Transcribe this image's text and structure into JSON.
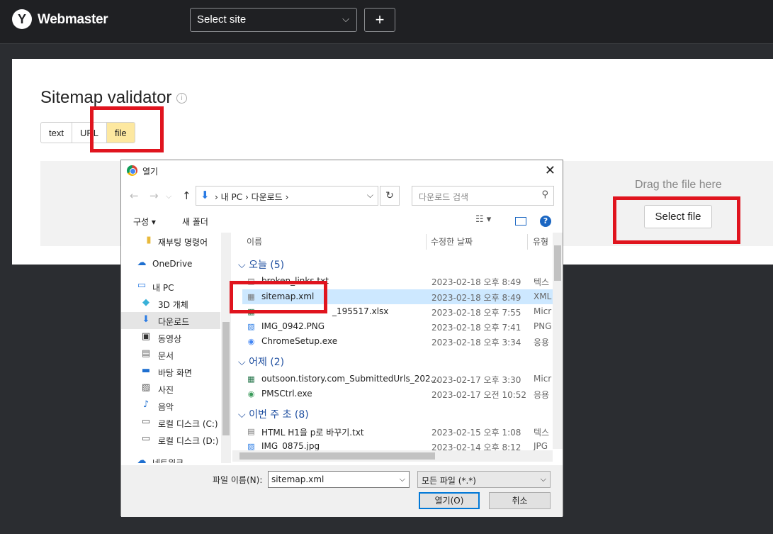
{
  "topbar": {
    "logo_letter": "Y",
    "brand": "Webmaster",
    "site_select": "Select site",
    "add_label": "+"
  },
  "page": {
    "title": "Sitemap validator",
    "info": "i",
    "tabs": [
      "text",
      "URL",
      "file"
    ],
    "active_tab": "file",
    "drag_text": "Drag the file here",
    "select_file": "Select file"
  },
  "dialog": {
    "title": "열기",
    "close": "✕",
    "breadcrumbs": [
      "내 PC",
      "다운로드"
    ],
    "search_placeholder": "다운로드 검색",
    "toolbar": {
      "organize": "구성 ▾",
      "new_folder": "새 폴더",
      "help": "?"
    },
    "nav_items": [
      {
        "label": "재부팅 명령어",
        "icon": "folder-icon"
      },
      {
        "label": "OneDrive",
        "icon": "cloud-icon"
      },
      {
        "label": "내 PC",
        "icon": "pc-icon"
      },
      {
        "label": "3D 개체",
        "icon": "cube-icon"
      },
      {
        "label": "다운로드",
        "icon": "download-icon",
        "selected": true
      },
      {
        "label": "동영상",
        "icon": "video-icon"
      },
      {
        "label": "문서",
        "icon": "document-icon"
      },
      {
        "label": "바탕 화면",
        "icon": "desktop-icon"
      },
      {
        "label": "사진",
        "icon": "picture-icon"
      },
      {
        "label": "음악",
        "icon": "music-icon"
      },
      {
        "label": "로컬 디스크 (C:)",
        "icon": "drive-icon"
      },
      {
        "label": "로컬 디스크 (D:)",
        "icon": "drive-icon"
      },
      {
        "label": "네트워크",
        "icon": "network-icon"
      }
    ],
    "columns": {
      "name": "이름",
      "date": "수정한 날짜",
      "type": "유형"
    },
    "groups": [
      {
        "label": "오늘 (5)",
        "files": [
          {
            "name": "broken_links.txt",
            "date": "2023-02-18 오후 8:49",
            "type": "텍스",
            "icon": "text-file-icon"
          },
          {
            "name": "sitemap.xml",
            "date": "2023-02-18 오후 8:49",
            "type": "XML",
            "icon": "xml-file-icon",
            "selected": true
          },
          {
            "name": "_195517.xlsx",
            "date": "2023-02-18 오후 7:55",
            "type": "Micr",
            "icon": "excel-file-icon"
          },
          {
            "name": "IMG_0942.PNG",
            "date": "2023-02-18 오후 7:41",
            "type": "PNG",
            "icon": "image-file-icon"
          },
          {
            "name": "ChromeSetup.exe",
            "date": "2023-02-18 오후 3:34",
            "type": "응용",
            "icon": "exe-file-icon"
          }
        ]
      },
      {
        "label": "어제 (2)",
        "files": [
          {
            "name": "outsoon.tistory.com_SubmittedUrls_202...",
            "date": "2023-02-17 오후 3:30",
            "type": "Micr",
            "icon": "excel-file-icon"
          },
          {
            "name": "PMSCtrl.exe",
            "date": "2023-02-17 오전 10:52",
            "type": "응용",
            "icon": "exe-file-icon"
          }
        ]
      },
      {
        "label": "이번 주 초 (8)",
        "files": [
          {
            "name": "HTML H1을 p로 바꾸기.txt",
            "date": "2023-02-15 오후 1:08",
            "type": "텍스",
            "icon": "text-file-icon"
          },
          {
            "name": "IMG_0875.jpg",
            "date": "2023-02-14 오후 8:12",
            "type": "JPG",
            "icon": "image-file-icon"
          }
        ]
      }
    ],
    "filename_label": "파일 이름(N):",
    "filename_value": "sitemap.xml",
    "filter_value": "모든 파일 (*.*)",
    "open_button": "열기(O)",
    "cancel_button": "취소"
  },
  "colors": {
    "highlight": "#e0141e",
    "accent": "#fde8a0",
    "selection": "#cde8ff"
  }
}
